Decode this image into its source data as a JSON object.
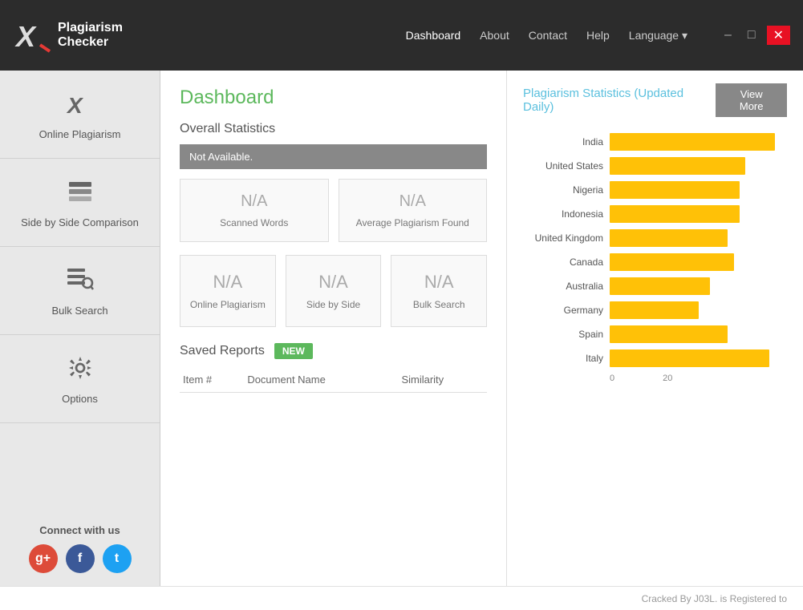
{
  "app": {
    "title": "Plagiarism Checker X",
    "logo_line1": "Plagiarism",
    "logo_line2": "Checker"
  },
  "nav": {
    "dashboard": "Dashboard",
    "about": "About",
    "contact": "Contact",
    "help": "Help",
    "language": "Language ▾"
  },
  "window_controls": {
    "minimize": "–",
    "maximize": "□",
    "close": "✕"
  },
  "sidebar": {
    "items": [
      {
        "label": "Online Plagiarism",
        "icon": "x-icon"
      },
      {
        "label": "Side by Side Comparison",
        "icon": "layers-icon"
      },
      {
        "label": "Bulk Search",
        "icon": "search-list-icon"
      },
      {
        "label": "Options",
        "icon": "gear-icon"
      }
    ],
    "connect_label": "Connect with us"
  },
  "dashboard": {
    "title": "Dashboard",
    "overall_statistics_label": "Overall Statistics",
    "not_available_text": "Not Available.",
    "scanned_words_value": "N/A",
    "scanned_words_label": "Scanned Words",
    "avg_plagiarism_value": "N/A",
    "avg_plagiarism_label": "Average Plagiarism Found",
    "online_plagiarism_value": "N/A",
    "online_plagiarism_label": "Online Plagiarism",
    "side_by_side_value": "N/A",
    "side_by_side_label": "Side by Side",
    "bulk_search_value": "N/A",
    "bulk_search_label": "Bulk Search",
    "saved_reports_label": "Saved Reports",
    "new_badge": "NEW",
    "table_headers": [
      "Item #",
      "Document Name",
      "Similarity"
    ]
  },
  "chart": {
    "title": "Plagiarism Statistics (Updated Daily)",
    "view_more": "View More",
    "max_value": 30,
    "axis_labels": [
      "0",
      "20"
    ],
    "bars": [
      {
        "label": "India",
        "value": 28
      },
      {
        "label": "United States",
        "value": 23
      },
      {
        "label": "Nigeria",
        "value": 22
      },
      {
        "label": "Indonesia",
        "value": 22
      },
      {
        "label": "United Kingdom",
        "value": 20
      },
      {
        "label": "Canada",
        "value": 21
      },
      {
        "label": "Australia",
        "value": 17
      },
      {
        "label": "Germany",
        "value": 15
      },
      {
        "label": "Spain",
        "value": 20
      },
      {
        "label": "Italy",
        "value": 27
      }
    ]
  },
  "footer": {
    "text": "Cracked By J03L. is Registered to"
  }
}
